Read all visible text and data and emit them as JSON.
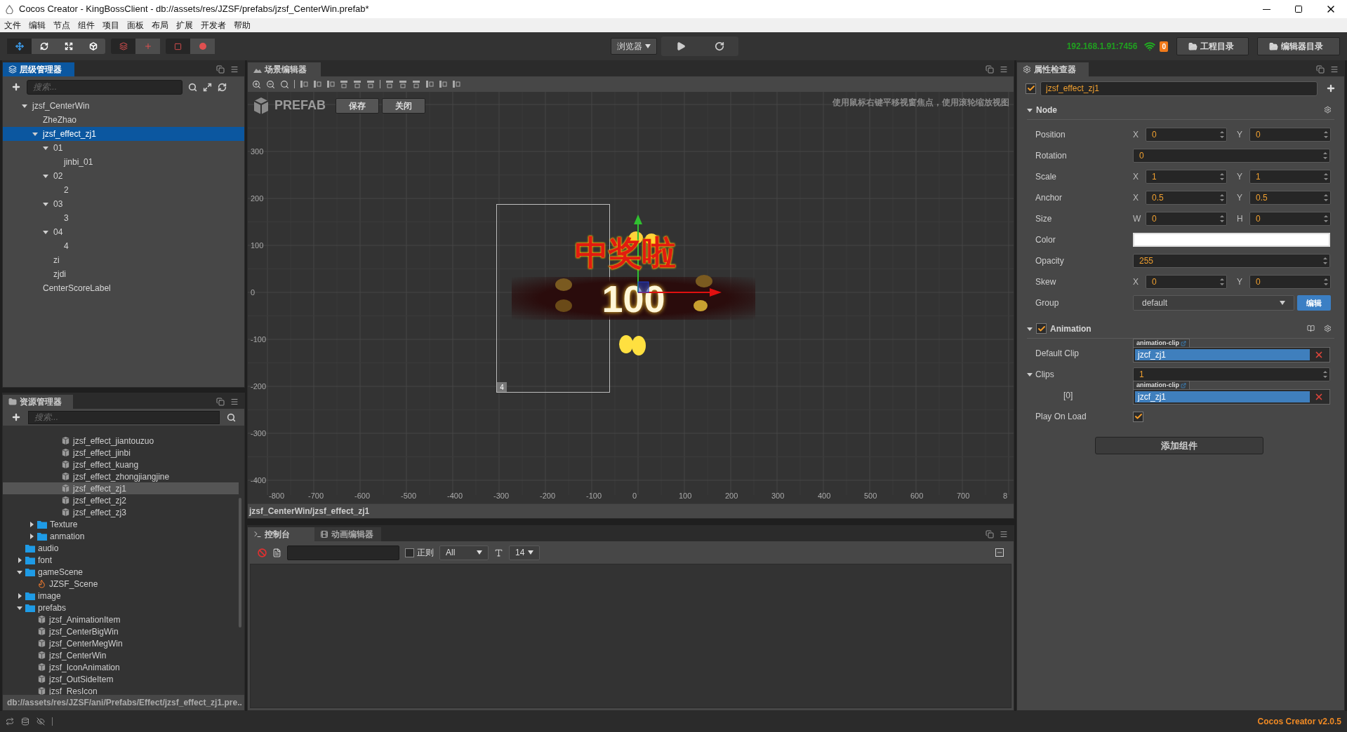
{
  "window": {
    "title": "Cocos Creator - KingBossClient - db://assets/res/JZSF/prefabs/jzsf_CenterWin.prefab*"
  },
  "menu": [
    "文件",
    "编辑",
    "节点",
    "组件",
    "项目",
    "面板",
    "布局",
    "扩展",
    "开发者",
    "帮助"
  ],
  "toolbar": {
    "tools": [
      {
        "selected": true
      },
      {
        "selected": false
      },
      {
        "selected": false
      },
      {
        "selected": false
      }
    ],
    "platform": "浏览器",
    "ip": "192.168.1.91:7456",
    "badge": "0",
    "buttons": [
      "工程目录",
      "编辑器目录"
    ]
  },
  "hierarchy": {
    "title": "层级管理器",
    "search_placeholder": "搜索...",
    "nodes": [
      {
        "label": "jzsf_CenterWin",
        "expanded": true,
        "selected": false,
        "children": [
          {
            "label": "ZheZhao",
            "selected": false
          },
          {
            "label": "jzsf_effect_zj1",
            "expanded": true,
            "selected": true,
            "children": [
              {
                "label": "01",
                "expanded": true,
                "selected": false,
                "children": [
                  {
                    "label": "jinbi_01",
                    "selected": false
                  }
                ]
              },
              {
                "label": "02",
                "expanded": true,
                "selected": false,
                "children": [
                  {
                    "label": "2",
                    "selected": false
                  }
                ]
              },
              {
                "label": "03",
                "expanded": true,
                "selected": false,
                "children": [
                  {
                    "label": "3",
                    "selected": false
                  }
                ]
              },
              {
                "label": "04",
                "expanded": true,
                "selected": false,
                "children": [
                  {
                    "label": "4",
                    "selected": false
                  }
                ]
              },
              {
                "label": "zi",
                "selected": false
              },
              {
                "label": "zjdi",
                "selected": false
              }
            ]
          },
          {
            "label": "CenterScoreLabel",
            "selected": false
          }
        ]
      }
    ]
  },
  "assets": {
    "title": "资源管理器",
    "search_placeholder": "搜索...",
    "tree": [
      {
        "children": [
          {
            "children": [
              {
                "children": [
                  {
                    "label": "jzsf_effect_jiantouzuo",
                    "kind": "prefab",
                    "selected": false
                  },
                  {
                    "label": "jzsf_effect_jinbi",
                    "kind": "prefab",
                    "selected": false
                  },
                  {
                    "label": "jzsf_effect_kuang",
                    "kind": "prefab",
                    "selected": false
                  },
                  {
                    "label": "jzsf_effect_zhongjiangjine",
                    "kind": "prefab",
                    "selected": false
                  },
                  {
                    "label": "jzsf_effect_zj1",
                    "kind": "prefab",
                    "selected": true
                  },
                  {
                    "label": "jzsf_effect_zj2",
                    "kind": "prefab",
                    "selected": false
                  },
                  {
                    "label": "jzsf_effect_zj3",
                    "kind": "prefab",
                    "selected": false
                  }
                ]
              }
            ]
          },
          {
            "label": "Texture",
            "kind": "folder",
            "expanded": false,
            "selected": false
          },
          {
            "label": "anmation",
            "kind": "folder",
            "expanded": false,
            "selected": false
          }
        ]
      },
      {
        "label": "audio",
        "kind": "folder",
        "selected": false
      },
      {
        "label": "font",
        "kind": "folder",
        "expanded": false,
        "selected": false
      },
      {
        "label": "gameScene",
        "kind": "folder",
        "expanded": true,
        "selected": false,
        "children": [
          {
            "label": "JZSF_Scene",
            "kind": "scene",
            "selected": false
          }
        ]
      },
      {
        "label": "image",
        "kind": "folder",
        "expanded": false,
        "selected": false
      },
      {
        "label": "prefabs",
        "kind": "folder",
        "expanded": true,
        "selected": false,
        "children": [
          {
            "label": "jzsf_AnimationItem",
            "kind": "prefab",
            "selected": false
          },
          {
            "label": "jzsf_CenterBigWin",
            "kind": "prefab",
            "selected": false
          },
          {
            "label": "jzsf_CenterMegWin",
            "kind": "prefab",
            "selected": false
          },
          {
            "label": "jzsf_CenterWin",
            "kind": "prefab",
            "selected": false
          },
          {
            "label": "jzsf_IconAnimation",
            "kind": "prefab",
            "selected": false
          },
          {
            "label": "jzsf_OutSideItem",
            "kind": "prefab",
            "selected": false
          },
          {
            "label": "jzsf_ResIcon",
            "kind": "prefab",
            "selected": false
          }
        ]
      }
    ],
    "path": "db://assets/res/JZSF/ani/Prefabs/Effect/jzsf_effect_zj1.pre.."
  },
  "scene": {
    "title": "场景编辑器",
    "prefab_label": "PREFAB",
    "buttons": [
      "保存",
      "关闭"
    ],
    "hint": "使用鼠标右键平移视窗焦点，使用滚轮缩放视图",
    "x_ticks": [
      "-800",
      "-700",
      "-600",
      "-500",
      "-400",
      "-300",
      "-200",
      "-100",
      "0",
      "100",
      "200",
      "300",
      "400",
      "500",
      "600",
      "700",
      "8"
    ],
    "y_ticks": [
      "300",
      "200",
      "100",
      "0",
      "-100",
      "-200",
      "-300",
      "-400"
    ],
    "selection_label": "4",
    "art_title": "中奖啦",
    "art_score": "100",
    "path": "jzsf_CenterWin/jzsf_effect_zj1"
  },
  "console": {
    "tabs": [
      {
        "label": "控制台",
        "selected": true
      },
      {
        "label": "动画编辑器",
        "selected": false
      }
    ],
    "regex": {
      "label": "正则",
      "checked": false
    },
    "level": "All",
    "font_size": "14"
  },
  "inspector": {
    "title": "属性检查器",
    "node_active": true,
    "node_name": "jzsf_effect_zj1",
    "sections": [
      {
        "title": "Node",
        "expanded": true,
        "rows": [
          {
            "kind": "xy",
            "label": "Position",
            "a": "X",
            "av": "0",
            "b": "Y",
            "bv": "0"
          },
          {
            "kind": "value",
            "label": "Rotation",
            "value": "0"
          },
          {
            "kind": "xy",
            "label": "Scale",
            "a": "X",
            "av": "1",
            "b": "Y",
            "bv": "1"
          },
          {
            "kind": "xy",
            "label": "Anchor",
            "a": "X",
            "av": "0.5",
            "b": "Y",
            "bv": "0.5"
          },
          {
            "kind": "xy",
            "label": "Size",
            "a": "W",
            "av": "0",
            "b": "H",
            "bv": "0"
          },
          {
            "kind": "color",
            "label": "Color",
            "color": "#ffffff"
          },
          {
            "kind": "value",
            "label": "Opacity",
            "value": "255"
          },
          {
            "kind": "xy",
            "label": "Skew",
            "a": "X",
            "av": "0",
            "b": "Y",
            "bv": "0"
          },
          {
            "kind": "select",
            "label": "Group",
            "value": "default",
            "button": "编辑"
          }
        ]
      },
      {
        "title": "Animation",
        "expanded": true,
        "enabled": true,
        "rows": [
          {
            "kind": "asset",
            "label": "Default Clip",
            "tag": "animation-clip",
            "value": "jzcf_zj1"
          },
          {
            "kind": "value",
            "label": "Clips",
            "expanded": true,
            "value": "1",
            "children": [
              {
                "kind": "asset",
                "label": "[0]",
                "tag": "animation-clip",
                "value": "jzcf_zj1"
              }
            ]
          },
          {
            "kind": "check",
            "label": "Play On Load",
            "checked": true
          }
        ]
      }
    ],
    "add_component": "添加组件"
  },
  "status": {
    "version": "Cocos Creator v2.0.5"
  }
}
